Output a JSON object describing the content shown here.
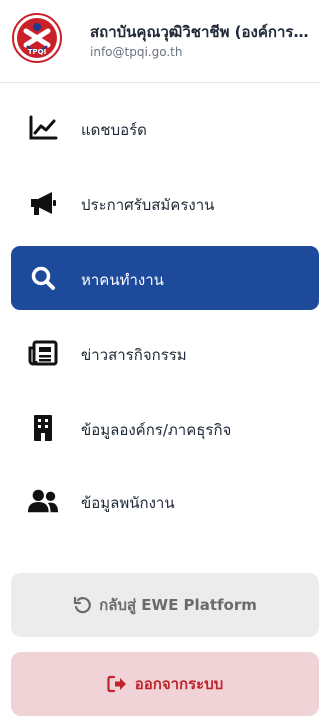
{
  "header": {
    "org_name": "สถาบันคุณวุฒิวิชาชีพ (องค์การมหาชน)",
    "email": "info@tpqi.go.th",
    "logo_text": "TPQI"
  },
  "nav": {
    "items": [
      {
        "label": "แดชบอร์ด",
        "icon": "chart-line-icon"
      },
      {
        "label": "ประกาศรับสมัครงาน",
        "icon": "megaphone-icon"
      },
      {
        "label": "หาคนทำงาน",
        "icon": "search-icon",
        "active": true
      },
      {
        "label": "ข่าวสารกิจกรรม",
        "icon": "newspaper-icon"
      },
      {
        "label": "ข้อมูลองค์กร/ภาคธุรกิจ",
        "icon": "building-icon"
      },
      {
        "label": "ข้อมูลพนักงาน",
        "icon": "users-icon"
      }
    ]
  },
  "footer": {
    "back_label": "กลับสู่ EWE Platform",
    "logout_label": "ออกจากระบบ"
  },
  "colors": {
    "active_bg": "#1e4a9c",
    "logout_text": "#c0242c",
    "logout_bg": "#f0d3d6",
    "back_bg": "#ececec"
  }
}
